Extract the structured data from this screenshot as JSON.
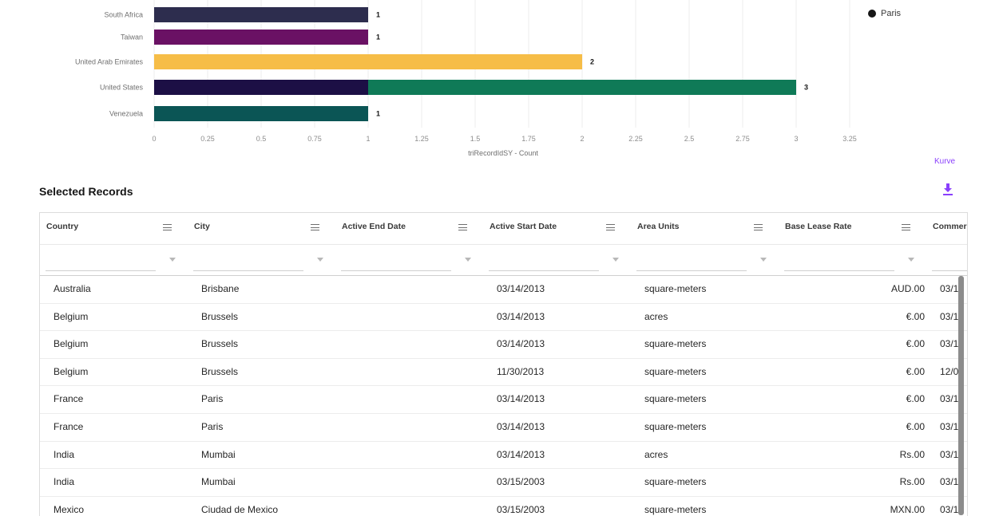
{
  "chart_data": {
    "type": "bar",
    "orientation": "horizontal",
    "stacked": true,
    "categories": [
      "South Africa",
      "Taiwan",
      "United Arab Emirates",
      "United States",
      "Venezuela"
    ],
    "segments": [
      {
        "category": "South Africa",
        "value": 1,
        "color": "#2d2d4e"
      },
      {
        "category": "Taiwan",
        "value": 1,
        "color": "#6a1164"
      },
      {
        "category": "United Arab Emirates",
        "value": 2,
        "color": "#f6bd47"
      },
      {
        "category": "United States",
        "value": 1,
        "color": "#1c0f45"
      },
      {
        "category": "United States",
        "value": 2,
        "color": "#0f7a57"
      },
      {
        "category": "Venezuela",
        "value": 1,
        "color": "#0b5555"
      }
    ],
    "totals": [
      "1",
      "1",
      "2",
      "3",
      "1"
    ],
    "xlabel": "triRecordIdSY - Count",
    "xlim": [
      0,
      3.25
    ],
    "xticks": [
      "0",
      "0.25",
      "0.5",
      "0.75",
      "1",
      "1.25",
      "1.5",
      "1.75",
      "2",
      "2.25",
      "2.5",
      "2.75",
      "3",
      "3.25"
    ],
    "grid": true,
    "legend": {
      "position": "top-right",
      "items": [
        "Paris"
      ]
    }
  },
  "legend_label": "Paris",
  "kurve_link": "Kurve",
  "section_title": "Selected Records",
  "table": {
    "columns": [
      "Country",
      "City",
      "Active End Date",
      "Active Start Date",
      "Area Units",
      "Base Lease Rate",
      "Commer"
    ],
    "rows": [
      [
        "Australia",
        "Brisbane",
        "",
        "03/14/2013",
        "square-meters",
        "AUD.00",
        "03/1"
      ],
      [
        "Belgium",
        "Brussels",
        "",
        "03/14/2013",
        "acres",
        "€.00",
        "03/1"
      ],
      [
        "Belgium",
        "Brussels",
        "",
        "03/14/2013",
        "square-meters",
        "€.00",
        "03/1"
      ],
      [
        "Belgium",
        "Brussels",
        "",
        "11/30/2013",
        "square-meters",
        "€.00",
        "12/0"
      ],
      [
        "France",
        "Paris",
        "",
        "03/14/2013",
        "square-meters",
        "€.00",
        "03/1"
      ],
      [
        "France",
        "Paris",
        "",
        "03/14/2013",
        "square-meters",
        "€.00",
        "03/1"
      ],
      [
        "India",
        "Mumbai",
        "",
        "03/14/2013",
        "acres",
        "Rs.00",
        "03/1"
      ],
      [
        "India",
        "Mumbai",
        "",
        "03/15/2003",
        "square-meters",
        "Rs.00",
        "03/1"
      ],
      [
        "Mexico",
        "Ciudad de Mexico",
        "",
        "03/15/2003",
        "square-meters",
        "MXN.00",
        "03/1"
      ]
    ]
  },
  "colors": {
    "accent": "#8a3ffc",
    "legend_dot": "#161616"
  },
  "icons": [
    "download-icon",
    "column-menu-icon",
    "filter-dropdown-icon"
  ]
}
